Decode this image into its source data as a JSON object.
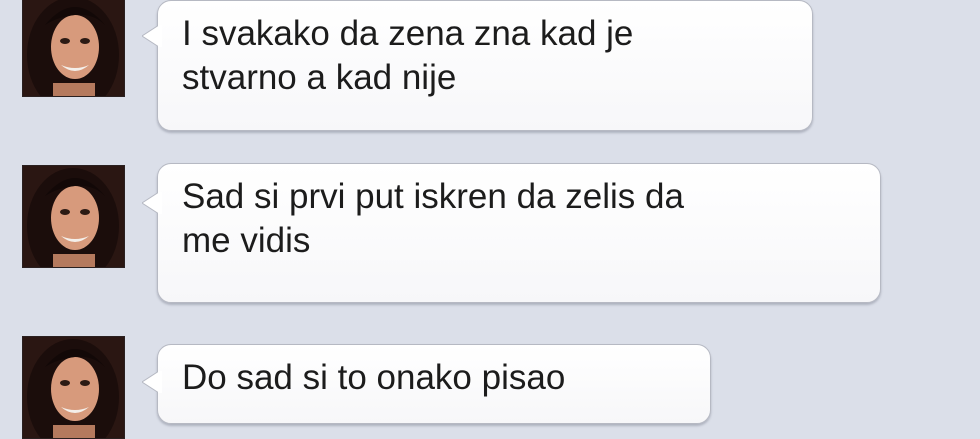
{
  "conversation": {
    "messages": [
      {
        "sender": "contact",
        "avatar_icon": "contact-avatar-photo",
        "lines": [
          "I svakako da zena zna kad je",
          "stvarno a kad nije"
        ]
      },
      {
        "sender": "contact",
        "avatar_icon": "contact-avatar-photo",
        "lines": [
          "Sad si prvi put iskren da zelis da",
          "me vidis"
        ]
      },
      {
        "sender": "contact",
        "avatar_icon": "contact-avatar-photo",
        "lines": [
          "Do sad si to onako pisao"
        ]
      }
    ]
  },
  "colors": {
    "background": "#dbdfe9",
    "bubble": "#ffffff",
    "bubble_border": "#b6b9c3",
    "text": "#1c1c1c"
  }
}
